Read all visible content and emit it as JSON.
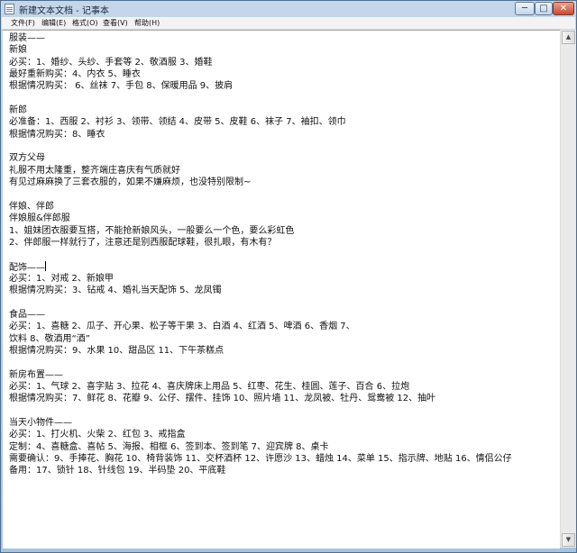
{
  "window": {
    "title": "新建文本文档 - 记事本",
    "minimize_label": "─",
    "maximize_label": "□",
    "close_label": "✕"
  },
  "menu": {
    "file": "文件(F)",
    "edit": "编辑(E)",
    "format": "格式(O)",
    "view": "查看(V)",
    "help": "帮助(H)"
  },
  "scrollbar": {
    "up_glyph": "▲",
    "down_glyph": "▼"
  },
  "document": {
    "lines": [
      "服装——",
      "新娘",
      "必买：1、婚纱、头纱、手套等 2、敬酒服 3、婚鞋",
      "最好重新购买：4、内衣 5、睡衣",
      "根据情况购买： 6、丝袜 7、手包 8、保暖用品 9、披肩",
      "",
      "新郎",
      "必准备：1、西服 2、衬衫 3、领带、领结 4、皮带 5、皮鞋 6、袜子 7、袖扣、领巾",
      "根据情况购买：8、睡衣",
      "",
      "双方父母",
      "礼服不用太隆重，整齐端庄喜庆有气质就好",
      "有见过麻麻换了三套衣服的，如果不嫌麻烦，也没特别限制~",
      "",
      "伴娘、伴郎",
      "伴娘服&伴郎服",
      "1、姐妹团衣服要互搭，不能抢新娘风头，一般要么一个色，要么彩虹色",
      "2、伴郎服一样就行了，注意还是别西服配球鞋，很扎眼，有木有？",
      "",
      "配饰——",
      "必买：1、对戒 2、新娘甲",
      "根据情况购买：3、钻戒 4、婚礼当天配饰 5、龙凤镯",
      "",
      "食品——",
      "必买：1、喜糖 2、瓜子、开心果、松子等干果 3、白酒 4、红酒 5、啤酒 6、香烟 7、",
      "饮料 8、敬酒用“酒”",
      "根据情况购买：9、水果 10、甜品区 11、下午茶糕点",
      "",
      "新房布置——",
      "必买：1、气球 2、喜字贴 3、拉花 4、喜庆牌床上用品 5、红枣、花生、桂圆、莲子、百合 6、拉炮",
      "根据情况购买：7、鲜花 8、花瓣 9、公仔、摆件、挂饰 10、照片墙 11、龙凤被、牡丹、鸳鸯被 12、抽叶",
      "",
      "当天小物件——",
      "必买：1、打火机、火柴 2、红包 3、戒指盒",
      "定制：4、喜糖盒、喜帖 5、海报、相框 6、签到本、签到笔 7、迎宾牌 8、桌卡",
      "需要确认：9、手捧花、胸花 10、椅背装饰 11、交杯酒杯 12、许愿沙 13、蜡烛 14、菜单 15、指示牌、地贴 16、情侣公仔",
      "备用：17、锁针 18、针线包 19、半码垫 20、平底鞋"
    ]
  }
}
